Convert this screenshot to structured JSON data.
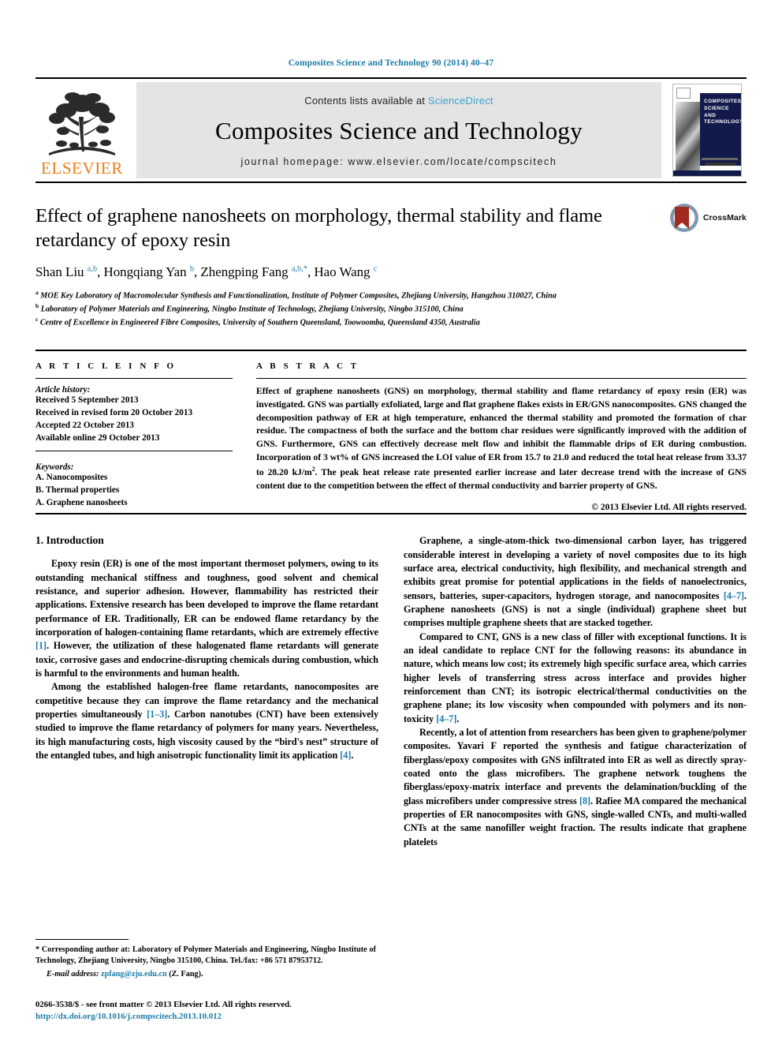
{
  "running_head": "Composites Science and Technology 90 (2014) 40–47",
  "masthead": {
    "contents_prefix": "Contents lists available at ",
    "sciencedirect": "ScienceDirect",
    "journal_name": "Composites Science and Technology",
    "homepage": "journal homepage: www.elsevier.com/locate/compscitech",
    "publisher": "ELSEVIER",
    "cover_title": "COMPOSITES SCIENCE AND TECHNOLOGY"
  },
  "article": {
    "title": "Effect of graphene nanosheets on morphology, thermal stability and flame retardancy of epoxy resin",
    "authors_html": "Shan Liu <sup>a,b</sup>, Hongqiang Yan <sup>b</sup>, Zhengping Fang <sup>a,b,*</sup>, Hao Wang <sup>c</sup>",
    "affiliations": [
      "MOE Key Laboratory of Macromolecular Synthesis and Functionalization, Institute of Polymer Composites, Zhejiang University, Hangzhou 310027, China",
      "Laboratory of Polymer Materials and Engineering, Ningbo Institute of Technology, Zhejiang University, Ningbo 315100, China",
      "Centre of Excellence in Engineered Fibre Composites, University of Southern Queensland, Toowoomba, Queensland 4350, Australia"
    ],
    "affiliation_marks": [
      "a",
      "b",
      "c"
    ],
    "crossmark_label": "CrossMark"
  },
  "article_info": {
    "heading": "A R T I C L E   I N F O",
    "history_label": "Article history:",
    "history": [
      "Received 5 September 2013",
      "Received in revised form 20 October 2013",
      "Accepted 22 October 2013",
      "Available online 29 October 2013"
    ],
    "keywords_label": "Keywords:",
    "keywords": [
      "A. Nanocomposites",
      "B. Thermal properties",
      "A. Graphene nanosheets"
    ]
  },
  "abstract": {
    "heading": "A B S T R A C T",
    "text_html": "Effect of graphene nanosheets (GNS) on morphology, thermal stability and flame retardancy of epoxy resin (ER) was investigated. GNS was partially exfoliated, large and flat graphene flakes exists in ER/GNS nanocomposites. GNS changed the decomposition pathway of ER at high temperature, enhanced the thermal stability and promoted the formation of char residue. The compactness of both the surface and the bottom char residues were significantly improved with the addition of GNS. Furthermore, GNS can effectively decrease melt flow and inhibit the flammable drips of ER during combustion. Incorporation of 3 wt% of GNS increased the LOI value of ER from 15.7 to 21.0 and reduced the total heat release from 33.37 to 28.20 kJ/m<sup>2</sup>. The peak heat release rate presented earlier increase and later decrease trend with the increase of GNS content due to the competition between the effect of thermal conductivity and barrier property of GNS.",
    "copyright": "© 2013 Elsevier Ltd. All rights reserved."
  },
  "body": {
    "section_title": "1. Introduction",
    "left_paragraphs_html": [
      "Epoxy resin (ER) is one of the most important thermoset polymers, owing to its outstanding mechanical stiffness and toughness, good solvent and chemical resistance, and superior adhesion. However, flammability has restricted their applications. Extensive research has been developed to improve the flame retardant performance of ER. Traditionally, ER can be endowed flame retardancy by the incorporation of halogen-containing flame retardants, which are extremely effective <span class=\"cite\">[1]</span>. However, the utilization of these halogenated flame retardants will generate toxic, corrosive gases and endocrine-disrupting chemicals during combustion, which is harmful to the environments and human health.",
      "Among the established halogen-free flame retardants, nanocomposites are competitive because they can improve the flame retardancy and the mechanical properties simultaneously <span class=\"cite\">[1–3]</span>. Carbon nanotubes (CNT) have been extensively studied to improve the flame retardancy of polymers for many years. Nevertheless, its high manufacturing costs, high viscosity caused by the &ldquo;bird's nest&rdquo; structure of the entangled tubes, and high anisotropic functionality limit its application <span class=\"cite\">[4]</span>."
    ],
    "right_paragraphs_html": [
      "Graphene, a single-atom-thick two-dimensional carbon layer, has triggered considerable interest in developing a variety of novel composites due to its high surface area, electrical conductivity, high flexibility, and mechanical strength and exhibits great promise for potential applications in the fields of nanoelectronics, sensors, batteries, super-capacitors, hydrogen storage, and nanocomposites <span class=\"cite\">[4–7]</span>. Graphene nanosheets (GNS) is not a single (individual) graphene sheet but comprises multiple graphene sheets that are stacked together.",
      "Compared to CNT, GNS is a new class of filler with exceptional functions. It is an ideal candidate to replace CNT for the following reasons: its abundance in nature, which means low cost; its extremely high specific surface area, which carries higher levels of transferring stress across interface and provides higher reinforcement than CNT; its isotropic electrical/thermal conductivities on the graphene plane; its low viscosity when compounded with polymers and its non-toxicity <span class=\"cite\">[4–7]</span>.",
      "Recently, a lot of attention from researchers has been given to graphene/polymer composites. Yavari F reported the synthesis and fatigue characterization of fiberglass/epoxy composites with GNS infiltrated into ER as well as directly spray-coated onto the glass microfibers. The graphene network toughens the fiberglass/epoxy-matrix interface and prevents the delamination/buckling of the glass microfibers under compressive stress <span class=\"cite\">[8]</span>. Rafiee MA compared the mechanical properties of ER nanocomposites with GNS, single-walled CNTs, and multi-walled CNTs at the same nanofiller weight fraction. The results indicate that graphene platelets"
    ]
  },
  "footnotes": {
    "corresponding_html": "* Corresponding author at: Laboratory of Polymer Materials and Engineering, Ningbo Institute of Technology, Zhejiang University, Ningbo 315100, China. Tel./fax: +86 571 87953712.",
    "email_label": "E-mail address:",
    "email": "zpfang@zju.edu.cn",
    "email_suffix": "(Z. Fang).",
    "issn_line": "0266-3538/$ - see front matter © 2013 Elsevier Ltd. All rights reserved.",
    "doi": "http://dx.doi.org/10.1016/j.compscitech.2013.10.012"
  },
  "colors": {
    "link_blue": "#1a7ba8",
    "sciencedirect_blue": "#3aa3cc",
    "elsevier_orange": "#ee7d11",
    "cover_navy": "#111a4a",
    "crossmark_red": "#a32a20"
  }
}
